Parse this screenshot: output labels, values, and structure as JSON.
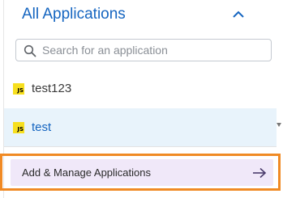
{
  "header": {
    "title": "All Applications",
    "toggle_icon": "chevron-up-icon"
  },
  "search": {
    "placeholder": "Search for an application",
    "value": "",
    "icon": "search-icon"
  },
  "applications": [
    {
      "name": "test123",
      "badge": "JS",
      "selected": false
    },
    {
      "name": "test",
      "badge": "JS",
      "selected": true
    }
  ],
  "footer": {
    "action_label": "Add & Manage Applications",
    "action_icon": "arrow-right-icon"
  },
  "colors": {
    "accent": "#1565c0",
    "selected_row": "#e8f3fb",
    "js_badge": "#f7df1e",
    "action_bg": "#f0e8f9",
    "highlight_outline": "#f08a24"
  }
}
